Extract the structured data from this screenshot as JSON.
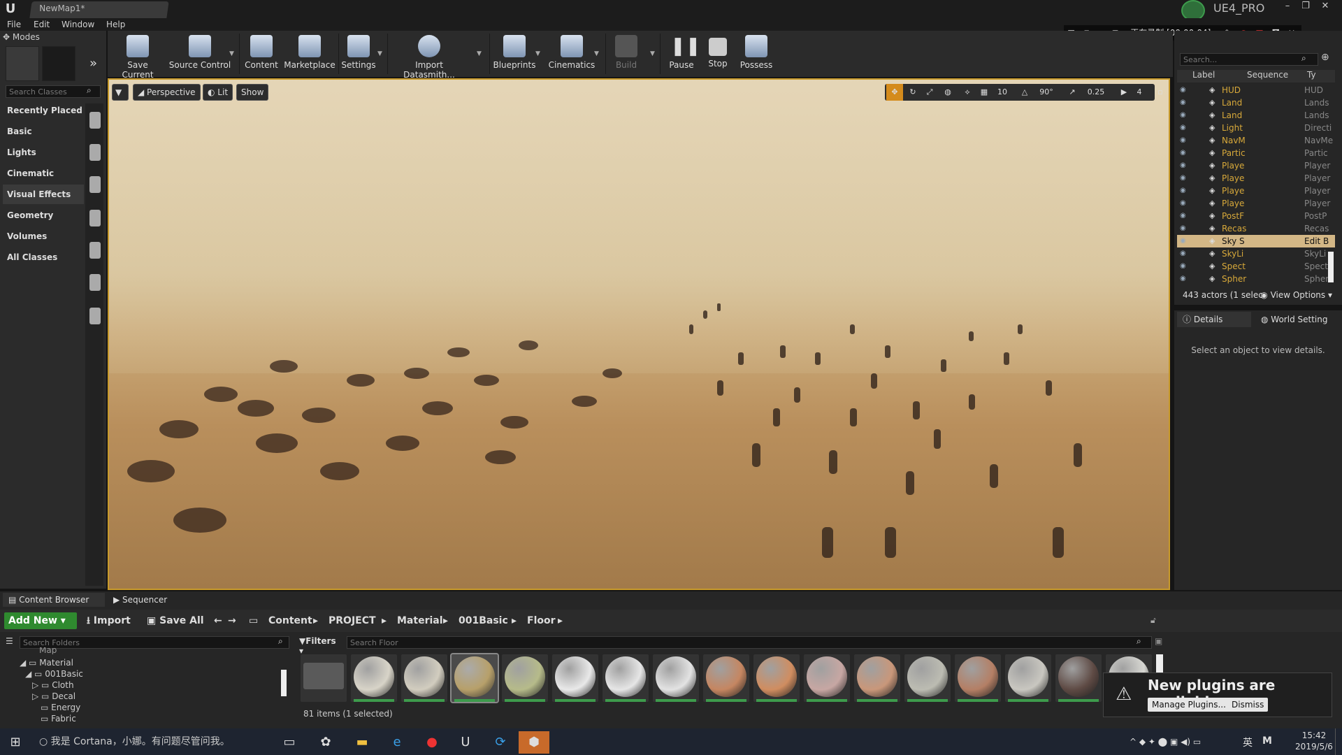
{
  "window": {
    "map_tab": "NewMap1*",
    "project": "UE4_PRO"
  },
  "menu": [
    "File",
    "Edit",
    "Window",
    "Help"
  ],
  "recorder": {
    "status": "正在录制 [00:00:04]"
  },
  "modes": {
    "title": "Modes",
    "search_placeholder": "Search Classes",
    "categories": [
      "Recently Placed",
      "Basic",
      "Lights",
      "Cinematic",
      "Visual Effects",
      "Geometry",
      "Volumes",
      "All Classes"
    ],
    "selected": "Visual Effects"
  },
  "toolbar": {
    "buttons": [
      "Save Current",
      "Source Control",
      "Content",
      "Marketplace",
      "Settings",
      "Import Datasmith...",
      "Blueprints",
      "Cinematics",
      "Build",
      "Pause",
      "Stop",
      "Possess"
    ]
  },
  "viewport": {
    "perspective": "Perspective",
    "lit": "Lit",
    "show": "Show",
    "grid_snap": "10",
    "rotation_snap": "90°",
    "scale_snap": "0.25",
    "camera_speed": "4"
  },
  "outliner": {
    "search_placeholder": "Search...",
    "headers": [
      "Label",
      "Sequence",
      "Ty"
    ],
    "rows": [
      {
        "label": "HUD",
        "type": "HUD"
      },
      {
        "label": "Land",
        "type": "Lands"
      },
      {
        "label": "Land",
        "type": "Lands"
      },
      {
        "label": "Light",
        "type": "Directi"
      },
      {
        "label": "NavM",
        "type": "NavMe"
      },
      {
        "label": "Partic",
        "type": "Partic"
      },
      {
        "label": "Playe",
        "type": "Player"
      },
      {
        "label": "Playe",
        "type": "Player"
      },
      {
        "label": "Playe",
        "type": "Player"
      },
      {
        "label": "Playe",
        "type": "Player"
      },
      {
        "label": "PostF",
        "type": "PostP"
      },
      {
        "label": "Recas",
        "type": "Recas"
      },
      {
        "label": "Sky S",
        "type": "Edit B"
      },
      {
        "label": "SkyLi",
        "type": "SkyLi"
      },
      {
        "label": "Spect",
        "type": "Specta"
      },
      {
        "label": "Spher",
        "type": "Spher"
      }
    ],
    "selected_index": 12,
    "footer": "443 actors (1 selec",
    "view_options": "View Options"
  },
  "details": {
    "tabs": [
      "Details",
      "World Setting"
    ],
    "message": "Select an object to view details."
  },
  "content_browser": {
    "tabs": [
      "Content Browser",
      "Sequencer"
    ],
    "add_new": "Add New",
    "import": "Import",
    "save_all": "Save All",
    "breadcrumb": [
      "Content",
      "PROJECT",
      "Material",
      "001Basic",
      "Floor"
    ],
    "folder_search_placeholder": "Search Folders",
    "tree": [
      "Map",
      "Material",
      "001Basic",
      "Cloth",
      "Decal",
      "Energy",
      "Fabric"
    ],
    "filters": "Filters",
    "asset_search_placeholder": "Search Floor",
    "items_count": "81 items (1 selected)",
    "asset_colors": [
      "#5a5a5a",
      "#d8d4c8",
      "#d2cdbf",
      "#b7a06a",
      "#b6bb8a",
      "#e9e9e9",
      "#e6e6e6",
      "#e3e3e3",
      "#c58661",
      "#d08d60",
      "#c7a7a3",
      "#c9977a",
      "#bcbcb2",
      "#b47f65",
      "#c9c7c0",
      "#5e4a44",
      "#d7d7d2"
    ]
  },
  "toast": {
    "title": "New plugins are available",
    "manage": "Manage Plugins...",
    "dismiss": "Dismiss"
  },
  "taskbar": {
    "cortana": "我是 Cortana，小娜。有问题尽管问我。",
    "time": "15:42",
    "date": "2019/5/6",
    "ime": "英"
  }
}
